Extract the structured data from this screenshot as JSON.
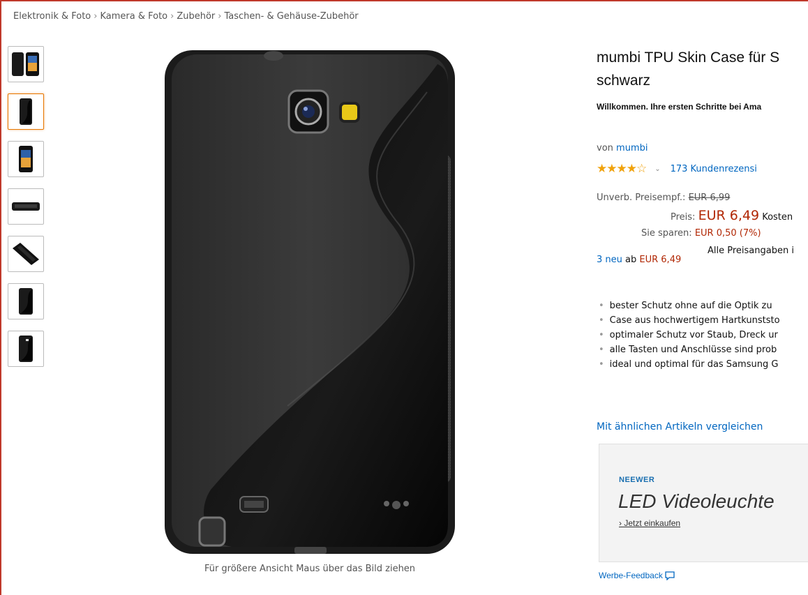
{
  "breadcrumb": {
    "items": [
      "Elektronik & Foto",
      "Kamera & Foto",
      "Zubehör",
      "Taschen- & Gehäuse-Zubehör"
    ],
    "separator": "›"
  },
  "gallery": {
    "thumbnail_count": 7,
    "selected_index": 1,
    "hint": "Für größere Ansicht Maus über das Bild ziehen"
  },
  "product": {
    "title_line1": "mumbi TPU Skin Case für S",
    "title_line2": "schwarz",
    "welcome": "Willkommen. Ihre ersten Schritte bei Ama",
    "by_prefix": "von",
    "brand": "mumbi",
    "rating_stars": 4,
    "rating_max": 5,
    "reviews": "173 Kundenrezensi"
  },
  "pricing": {
    "list_label": "Unverb. Preisempf.:",
    "list_price": "EUR 6,99",
    "price_label": "Preis:",
    "price": "EUR 6,49",
    "price_suffix": "Kosten",
    "savings_label": "Sie sparen:",
    "savings": "EUR 0,50 (7%)",
    "note": "Alle Preisangaben i"
  },
  "offers": {
    "count_link": "3 neu",
    "middle": "ab",
    "price": "EUR 6,49"
  },
  "bullets": [
    "bester Schutz ohne auf die Optik zu",
    "Case aus hochwertigem Hartkunststo",
    "optimaler Schutz vor Staub, Dreck ur",
    "alle Tasten und Anschlüsse sind prob",
    "ideal und optimal für das Samsung G"
  ],
  "compare_link": "Mit ähnlichen Artikeln vergleichen",
  "ad": {
    "brand": "NEEWER",
    "headline": "LED Videoleuchte",
    "cta": "› Jetzt einkaufen"
  },
  "feedback": "Werbe-Feedback",
  "colors": {
    "link": "#0066c0",
    "price_red": "#b12704",
    "star": "#f0a20c",
    "selected_thumb": "#e77600",
    "frame": "#c0392b"
  }
}
